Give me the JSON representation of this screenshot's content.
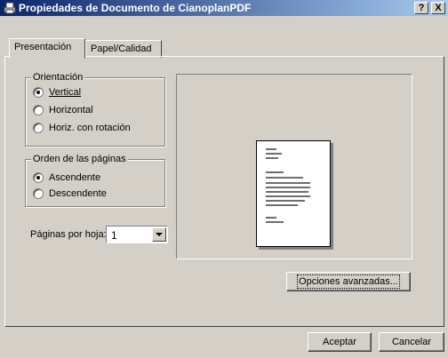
{
  "window": {
    "title": "Propiedades de Documento de CianoplanPDF",
    "help_btn": "?",
    "close_btn": "X"
  },
  "tabs": [
    {
      "label": "Presentación",
      "active": true
    },
    {
      "label": "Papel/Calidad",
      "active": false
    }
  ],
  "orientation": {
    "title": "Orientación",
    "options": [
      {
        "label": "Vertical",
        "selected": true
      },
      {
        "label": "Horizontal",
        "selected": false
      },
      {
        "label": "Horiz. con rotación",
        "selected": false
      }
    ]
  },
  "page_order": {
    "title": "Orden de las páginas",
    "options": [
      {
        "label": "Ascendente",
        "selected": true
      },
      {
        "label": "Descendente",
        "selected": false
      }
    ]
  },
  "pages_per_sheet": {
    "label": "Páginas por hoja:",
    "value": "1"
  },
  "buttons": {
    "advanced": "Opciones avanzadas...",
    "ok": "Aceptar",
    "cancel": "Cancelar"
  }
}
